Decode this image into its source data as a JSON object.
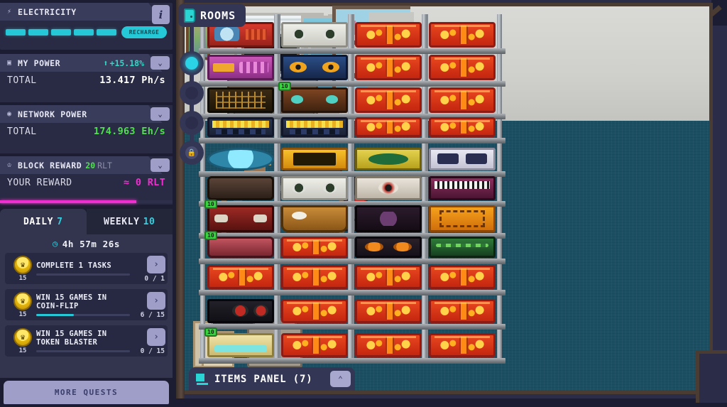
{
  "hud": {
    "electricity": {
      "title": "Electricity",
      "icon": "lightning-bolt-icon",
      "info_label": "i",
      "segments_total": 5,
      "segments_filled": 5,
      "recharge_label": "Recharge",
      "accent": "#25c8d6"
    },
    "my_power": {
      "title": "My power",
      "icon": "cpu-icon",
      "delta": "+15.18%",
      "delta_direction": "up",
      "total_label": "Total",
      "total_value": "13.417 Ph/s",
      "chevron": "chevron-down",
      "accent": "#2fd9c6"
    },
    "network_power": {
      "title": "Network power",
      "icon": "globe-icon",
      "total_label": "Total",
      "total_value": "174.963 Eh/s",
      "chevron": "chevron-down",
      "accent": "#4fe04f"
    },
    "block_reward": {
      "title": "Block reward",
      "icon": "trophy-icon",
      "amount": "20",
      "unit": "RLT",
      "your_label": "Your reward",
      "your_value": "≈ 0 RLT",
      "progress_percent": 79,
      "chevron": "chevron-down",
      "accent": "#ef2fd0"
    },
    "tabs": [
      {
        "label": "Daily",
        "count": "7",
        "active": true
      },
      {
        "label": "Weekly",
        "count": "10",
        "active": false
      }
    ],
    "quest_panel": {
      "timer_icon": "clock-icon",
      "timer": "4h 57m 26s",
      "quests": [
        {
          "reward": "15",
          "badge_icon": "crown-icon",
          "title": "Complete 1 Tasks",
          "progress": "0 / 1",
          "percent": 0,
          "go_icon": "chevron-right-icon"
        },
        {
          "reward": "15",
          "badge_icon": "crown-icon",
          "title": "Win 15 Games in Coin-Flip",
          "progress": "6 / 15",
          "percent": 40,
          "go_icon": "chevron-right-icon"
        },
        {
          "reward": "15",
          "badge_icon": "crown-icon",
          "title": "Win 15 Games in Token Blaster",
          "progress": "0 / 15",
          "percent": 0,
          "go_icon": "chevron-right-icon"
        }
      ],
      "more_quests_label": "More quests"
    }
  },
  "rooms_tab": {
    "label": "Rooms",
    "icon": "door-icon"
  },
  "room_rail": {
    "nodes": [
      {
        "name": "room-node-1",
        "state": "active"
      },
      {
        "name": "room-node-2",
        "state": "available"
      },
      {
        "name": "room-node-3",
        "state": "available"
      },
      {
        "name": "room-node-4",
        "state": "locked",
        "icon": "lock-icon"
      }
    ]
  },
  "items_panel": {
    "label": "Items panel (7)",
    "icon": "cart-icon",
    "toggle_icon": "chevron-up-icon"
  },
  "scene": {
    "name": "pixel-art-mining-room",
    "floor_color": "#1d4f63",
    "wall_color": "#d9d9d6",
    "props": [
      "tv",
      "tv-stand",
      "window",
      "glass-door",
      "wall-shelf",
      "picture",
      "desk",
      "monitor",
      "pc-tower",
      "fan",
      "character",
      "sofa",
      "boxes"
    ]
  },
  "shelves": [
    {
      "col": 0,
      "items": [
        {
          "type": "itm-arcade",
          "badge": null
        },
        {
          "type": "itm-cannon",
          "badge": null
        },
        {
          "type": "itm-circuit",
          "badge": null
        },
        {
          "type": "itm-popcorn",
          "badge": null
        },
        {
          "type": "itm-crystal",
          "badge": null
        },
        {
          "type": "itm-rock",
          "badge": null
        },
        {
          "type": "itm-crab",
          "badge": "10"
        },
        {
          "type": "itm-meat",
          "badge": "10"
        },
        {
          "type": "rig",
          "badge": null
        },
        {
          "type": "itm-speaker",
          "badge": null
        },
        {
          "type": "itm-console",
          "badge": "10"
        }
      ]
    },
    {
      "col": 1,
      "items": [
        {
          "type": "itm-skull",
          "badge": null
        },
        {
          "type": "itm-eyes",
          "badge": null
        },
        {
          "type": "itm-monster",
          "badge": "10"
        },
        {
          "type": "itm-popcorn",
          "badge": null
        },
        {
          "type": "itm-show",
          "badge": null
        },
        {
          "type": "itm-skull",
          "badge": null
        },
        {
          "type": "itm-boat",
          "badge": null
        },
        {
          "type": "rig",
          "badge": null
        },
        {
          "type": "rig",
          "badge": null
        },
        {
          "type": "rig",
          "badge": null
        },
        {
          "type": "rig",
          "badge": null
        }
      ]
    },
    {
      "col": 2,
      "items": [
        {
          "type": "rig",
          "badge": null
        },
        {
          "type": "rig",
          "badge": null
        },
        {
          "type": "rig",
          "badge": null
        },
        {
          "type": "rig",
          "badge": null
        },
        {
          "type": "itm-cash",
          "badge": null
        },
        {
          "type": "itm-eyeball",
          "badge": null
        },
        {
          "type": "itm-dark",
          "badge": null
        },
        {
          "type": "itm-pumpkin",
          "badge": null
        },
        {
          "type": "rig",
          "badge": null
        },
        {
          "type": "rig",
          "badge": null
        },
        {
          "type": "rig",
          "badge": null
        }
      ]
    },
    {
      "col": 3,
      "items": [
        {
          "type": "rig",
          "badge": null
        },
        {
          "type": "rig",
          "badge": null
        },
        {
          "type": "rig",
          "badge": null
        },
        {
          "type": "rig",
          "badge": null
        },
        {
          "type": "itm-dice",
          "badge": null
        },
        {
          "type": "itm-piano",
          "badge": null
        },
        {
          "type": "itm-ticket",
          "badge": null
        },
        {
          "type": "itm-snake",
          "badge": null
        },
        {
          "type": "rig",
          "badge": null
        },
        {
          "type": "rig",
          "badge": null
        },
        {
          "type": "rig",
          "badge": null
        }
      ]
    }
  ]
}
